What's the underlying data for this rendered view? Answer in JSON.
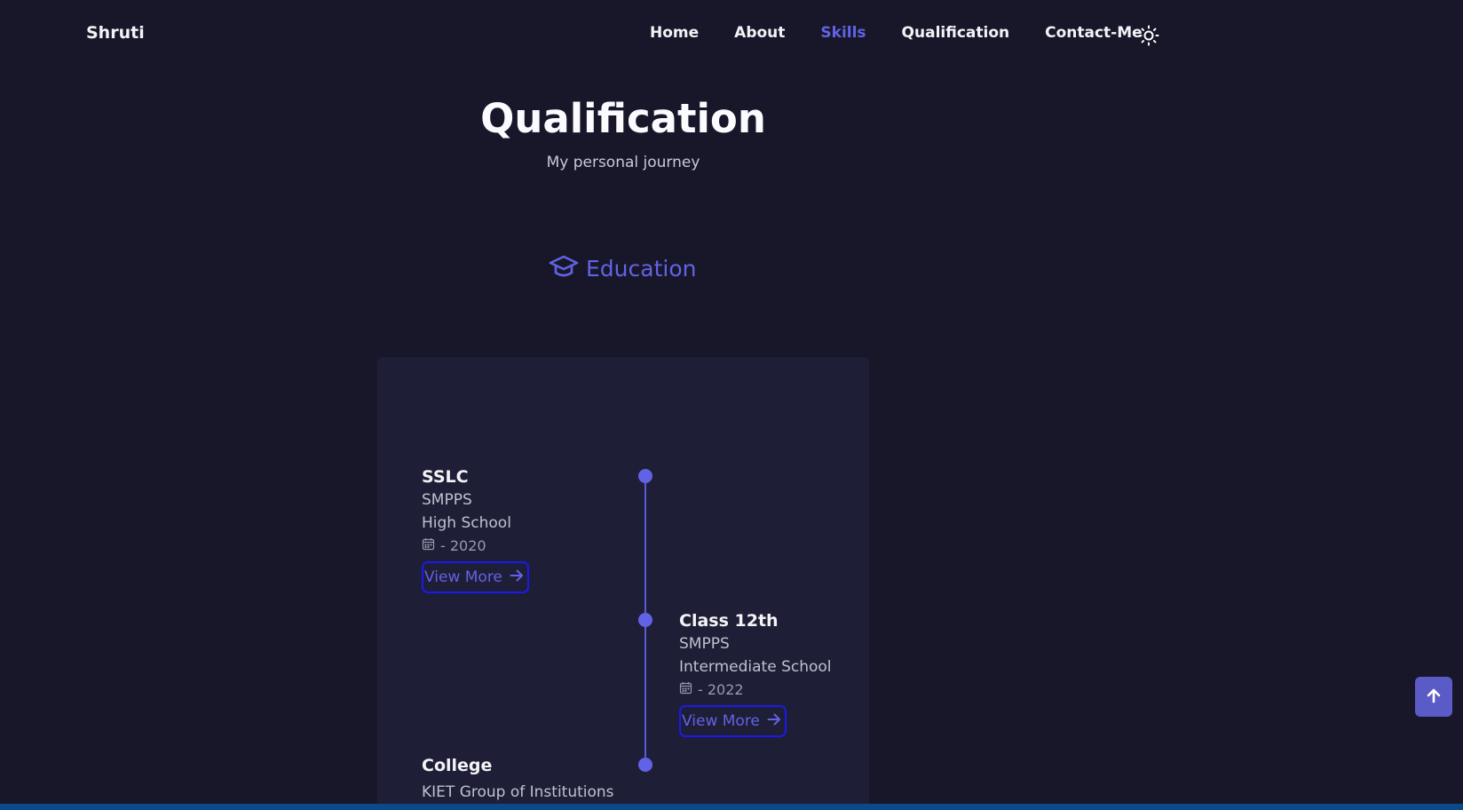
{
  "nav": {
    "logo": "Shruti",
    "links": [
      {
        "label": "Home"
      },
      {
        "label": "About"
      },
      {
        "label": "Skills",
        "active": true
      },
      {
        "label": "Qualification"
      },
      {
        "label": "Contact-Me"
      }
    ],
    "theme_toggle_icon": "sun-icon"
  },
  "section": {
    "title": "Qualification",
    "subtitle": "My personal journey"
  },
  "tabs": {
    "education": {
      "label": "Education",
      "icon": "graduation-cap-icon"
    }
  },
  "timeline": [
    {
      "title": "SSLC",
      "institution": "SMPPS",
      "type": "High School",
      "date": "- 2020",
      "button": "View More"
    },
    {
      "title": "Class 12th",
      "institution": "SMPPS",
      "type": "Intermediate School",
      "date": "- 2022",
      "button": "View More"
    },
    {
      "title": "College",
      "institution": "KIET Group of Institutions"
    }
  ],
  "colors": {
    "background": "#171729",
    "card": "#1e1e36",
    "accent": "#6262e6",
    "button_border": "#1a1aee"
  },
  "scroll_up_icon": "arrow-up-icon"
}
